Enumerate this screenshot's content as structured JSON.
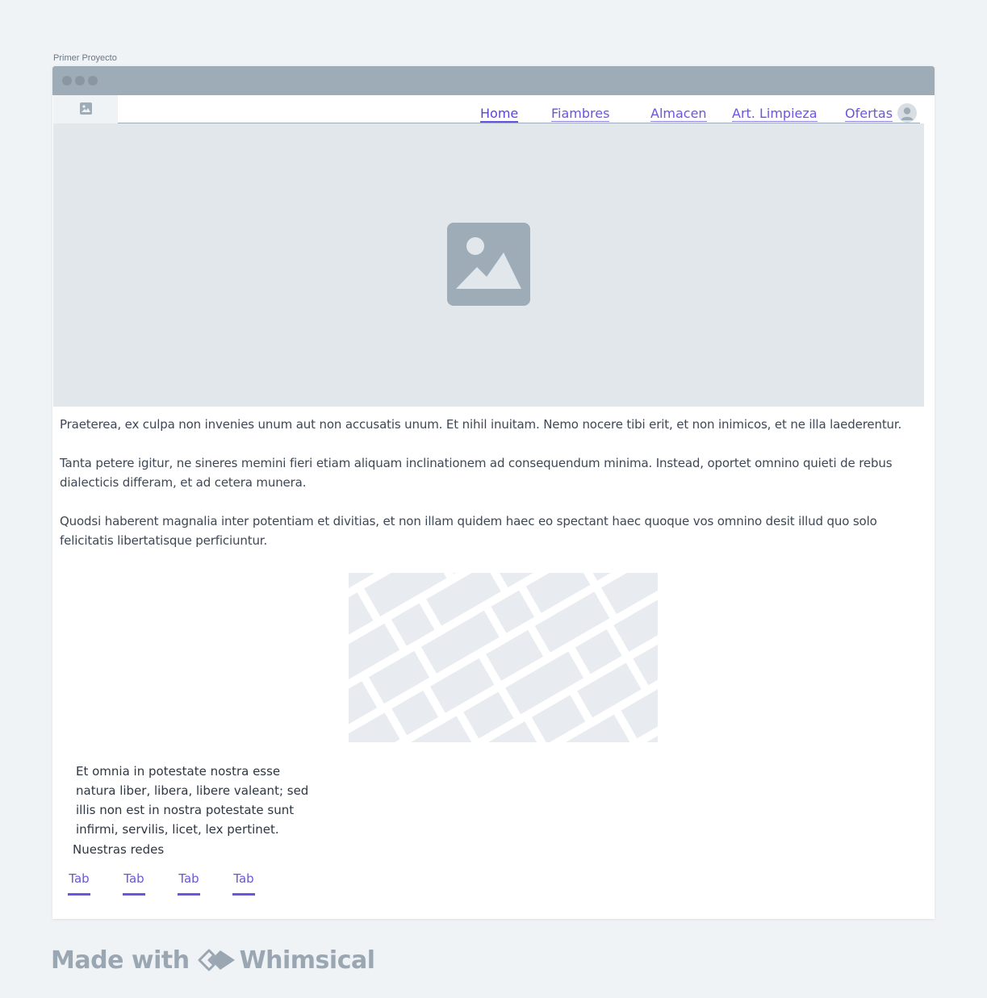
{
  "project": {
    "title": "Primer Proyecto"
  },
  "nav": {
    "items": [
      {
        "label": "Home",
        "active": true
      },
      {
        "label": "Fiambres"
      },
      {
        "label": "Almacen"
      },
      {
        "label": "Art. Limpieza"
      },
      {
        "label": "Ofertas"
      }
    ]
  },
  "content": {
    "paragraphs": [
      "Praeterea, ex culpa non invenies unum aut non accusatis unum. Et nihil inuitam. Nemo nocere tibi erit, et non inimicos, et ne illa laederentur.",
      "Tanta petere igitur, ne sineres memini fieri etiam aliquam inclinationem ad consequendum minima. Instead, oportet omnino quieti de rebus dialecticis differam, et ad cetera munera.",
      "Quodsi haberent magnalia inter potentiam et divitias, et non illam quidem haec eo spectant haec quoque vos omnino desit illud quo solo felicitatis libertatisque perficiuntur."
    ]
  },
  "footer": {
    "text": "Et omnia in potestate nostra esse natura liber, libera, libere valeant; sed illis non est in nostra potestate sunt infirmi, servilis, licet, lex pertinet.",
    "social_label": "Nuestras redes",
    "tabs": [
      "Tab",
      "Tab",
      "Tab",
      "Tab"
    ]
  },
  "branding": {
    "made_with": "Made with",
    "brand": "Whimsical"
  },
  "colors": {
    "accent": "#6b55e0",
    "placeholder": "#9eacb7",
    "background": "#eff3f6"
  }
}
